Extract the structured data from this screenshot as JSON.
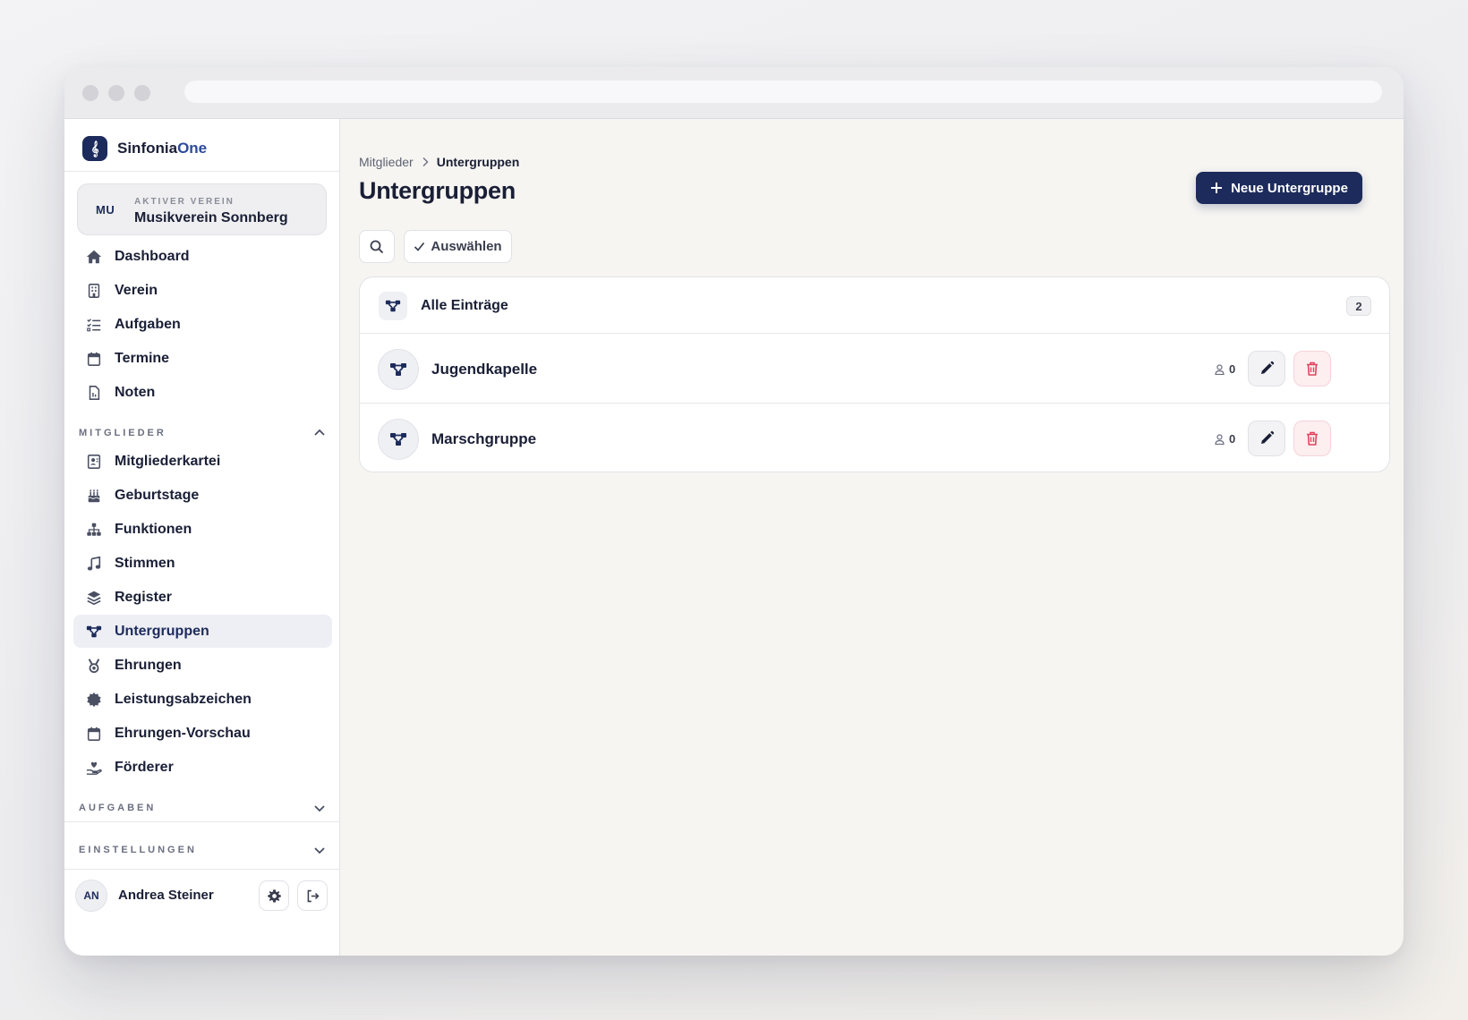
{
  "app": {
    "name_part1": "Sinfonia",
    "name_part2": "One",
    "logo_icon": "treble-clef-icon"
  },
  "verein": {
    "initials": "MU",
    "label": "AKTIVER VEREIN",
    "name": "Musikverein Sonnberg"
  },
  "nav_main": [
    {
      "label": "Dashboard",
      "icon": "home-icon"
    },
    {
      "label": "Verein",
      "icon": "building-icon"
    },
    {
      "label": "Aufgaben",
      "icon": "checklist-icon"
    },
    {
      "label": "Termine",
      "icon": "calendar-icon"
    },
    {
      "label": "Noten",
      "icon": "document-icon"
    }
  ],
  "section_mitglieder": {
    "label": "MITGLIEDER",
    "expanded": true
  },
  "nav_mitglieder": [
    {
      "label": "Mitgliederkartei",
      "icon": "contact-card-icon"
    },
    {
      "label": "Geburtstage",
      "icon": "cake-icon"
    },
    {
      "label": "Funktionen",
      "icon": "hierarchy-icon"
    },
    {
      "label": "Stimmen",
      "icon": "music-note-icon"
    },
    {
      "label": "Register",
      "icon": "layers-icon"
    },
    {
      "label": "Untergruppen",
      "icon": "subgroup-icon",
      "active": true
    },
    {
      "label": "Ehrungen",
      "icon": "medal-icon"
    },
    {
      "label": "Leistungsabzeichen",
      "icon": "badge-icon"
    },
    {
      "label": "Ehrungen-Vorschau",
      "icon": "calendar-icon"
    },
    {
      "label": "Förderer",
      "icon": "hand-heart-icon"
    }
  ],
  "section_aufgaben": {
    "label": "AUFGABEN",
    "expanded": false
  },
  "section_einstellungen": {
    "label": "EINSTELLUNGEN",
    "expanded": false
  },
  "user": {
    "initials": "AN",
    "name": "Andrea Steiner"
  },
  "breadcrumb": {
    "parent": "Mitglieder",
    "current": "Untergruppen"
  },
  "page": {
    "title": "Untergruppen",
    "new_button": "Neue Untergruppe",
    "select_button": "Auswählen"
  },
  "list": {
    "header_label": "Alle Einträge",
    "count": "2",
    "rows": [
      {
        "name": "Jugendkapelle",
        "members": "0"
      },
      {
        "name": "Marschgruppe",
        "members": "0"
      }
    ]
  },
  "colors": {
    "primary": "#1d2b5c",
    "danger": "#e0435e",
    "background": "#f6f5f2"
  }
}
